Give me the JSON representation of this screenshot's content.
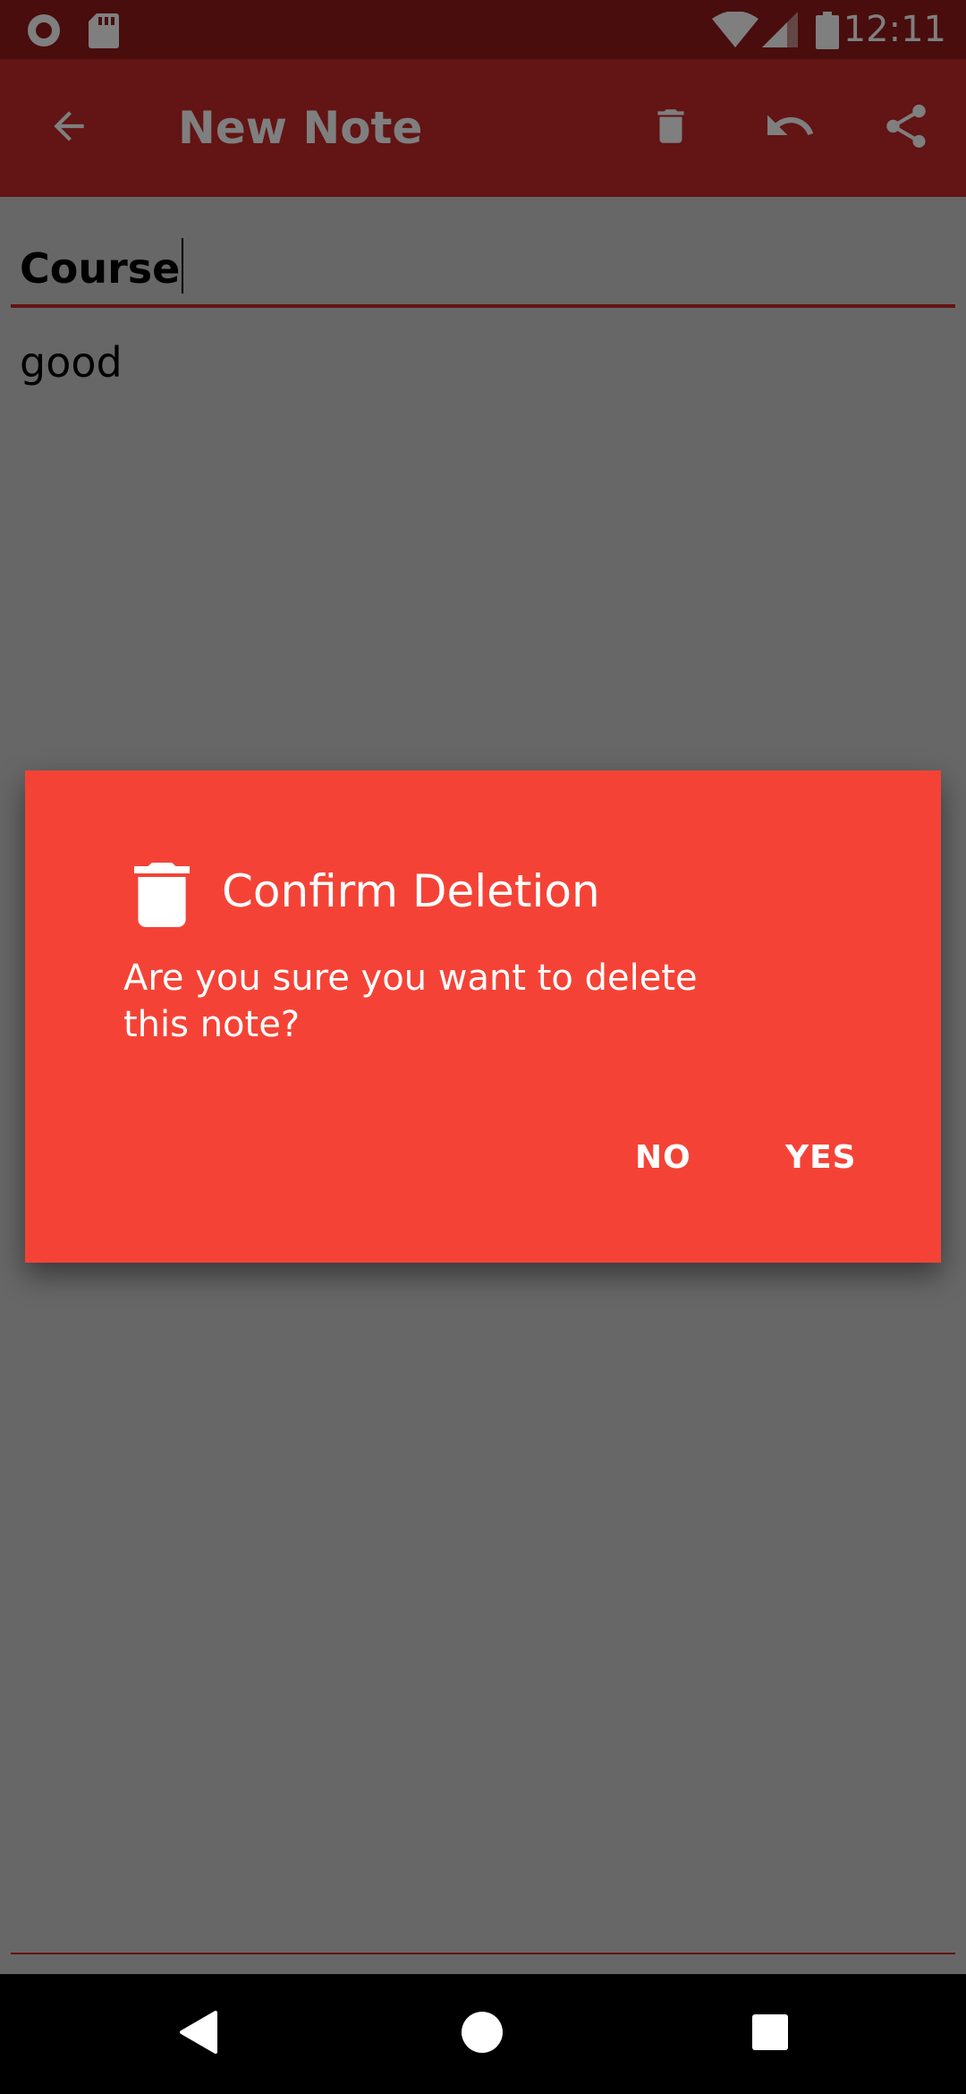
{
  "status_bar": {
    "time": "12:11",
    "icons": [
      "record-icon",
      "sd-card-icon",
      "wifi-icon",
      "signal-icon",
      "battery-icon"
    ]
  },
  "app_bar": {
    "title": "New Note",
    "actions": [
      "back-arrow-icon",
      "delete-icon",
      "undo-icon",
      "share-icon"
    ]
  },
  "note": {
    "title": "Course",
    "body": "good"
  },
  "dialog": {
    "title": "Confirm Deletion",
    "message": "Are you sure you want to delete this note?",
    "no_label": "NO",
    "yes_label": "YES",
    "icon": "delete-icon"
  },
  "nav_bar": {
    "icons": [
      "back-icon",
      "home-icon",
      "recents-icon"
    ]
  },
  "colors": {
    "primary": "#c62828",
    "status_bar": "#921a1a",
    "dialog_background": "#f44336",
    "text_on_primary": "#ffffff"
  }
}
